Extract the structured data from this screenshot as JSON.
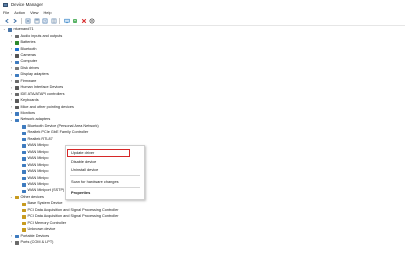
{
  "window": {
    "title": "Device Manager"
  },
  "menu": [
    "File",
    "Action",
    "View",
    "Help"
  ],
  "toolbar": [
    {
      "name": "back-icon",
      "color": "#3a6ea5"
    },
    {
      "name": "forward-icon",
      "color": "#3a6ea5"
    },
    {
      "name": "properties-icon",
      "color": "#5a7fa8"
    },
    {
      "name": "view-icon",
      "color": "#5a7fa8"
    },
    {
      "name": "help-icon",
      "color": "#3a6ea5"
    },
    {
      "name": "details-icon",
      "color": "#5a7fa8"
    },
    {
      "name": "monitor-icon",
      "color": "#2d7fc4"
    },
    {
      "name": "update-driver-icon",
      "color": "#2a9d3a"
    },
    {
      "name": "uninstall-icon",
      "color": "#d62828"
    },
    {
      "name": "scan-hardware-icon",
      "color": "#333333"
    }
  ],
  "tree": [
    {
      "label": "ntuenand71",
      "level": 0,
      "chev": "v",
      "color": "#4a76a8"
    },
    {
      "label": "Audio inputs and outputs",
      "level": 1,
      "chev": ">",
      "color": "#6b6b6b"
    },
    {
      "label": "Batteries",
      "level": 1,
      "chev": ">",
      "color": "#2d8a2d"
    },
    {
      "label": "Bluetooth",
      "level": 1,
      "chev": ">",
      "color": "#1e6fd0"
    },
    {
      "label": "Cameras",
      "level": 1,
      "chev": ">",
      "color": "#555555"
    },
    {
      "label": "Computer",
      "level": 1,
      "chev": ">",
      "color": "#3e7bbf"
    },
    {
      "label": "Disk drives",
      "level": 1,
      "chev": ">",
      "color": "#7a7a7a"
    },
    {
      "label": "Display adapters",
      "level": 1,
      "chev": ">",
      "color": "#3e7bbf"
    },
    {
      "label": "Firmware",
      "level": 1,
      "chev": ">",
      "color": "#6a6a6a"
    },
    {
      "label": "Human Interface Devices",
      "level": 1,
      "chev": ">",
      "color": "#5a5a5a"
    },
    {
      "label": "IDE ATA/ATAPI controllers",
      "level": 1,
      "chev": ">",
      "color": "#6a6a6a"
    },
    {
      "label": "Keyboards",
      "level": 1,
      "chev": ">",
      "color": "#5a5a5a"
    },
    {
      "label": "Mice and other pointing devices",
      "level": 1,
      "chev": ">",
      "color": "#5a5a5a"
    },
    {
      "label": "Monitors",
      "level": 1,
      "chev": ">",
      "color": "#3e7bbf"
    },
    {
      "label": "Network adapters",
      "level": 1,
      "chev": "v",
      "color": "#3e7bbf"
    },
    {
      "label": "Bluetooth Device (Personal Area Network)",
      "level": 2,
      "chev": "",
      "color": "#3e7bbf"
    },
    {
      "label": "Realtek PCIe GbE Family Controller",
      "level": 2,
      "chev": "",
      "color": "#3e7bbf"
    },
    {
      "label": "Realtek RTL87",
      "level": 2,
      "chev": "",
      "color": "#3e7bbf"
    },
    {
      "label": "WAN Minipo",
      "level": 2,
      "chev": "",
      "color": "#3e7bbf"
    },
    {
      "label": "WAN Minipo",
      "level": 2,
      "chev": "",
      "color": "#3e7bbf"
    },
    {
      "label": "WAN Minipo",
      "level": 2,
      "chev": "",
      "color": "#3e7bbf"
    },
    {
      "label": "WAN Minipo",
      "level": 2,
      "chev": "",
      "color": "#3e7bbf"
    },
    {
      "label": "WAN Minipo",
      "level": 2,
      "chev": "",
      "color": "#3e7bbf"
    },
    {
      "label": "WAN Minipo",
      "level": 2,
      "chev": "",
      "color": "#3e7bbf"
    },
    {
      "label": "WAN Minipo",
      "level": 2,
      "chev": "",
      "color": "#3e7bbf"
    },
    {
      "label": "WAN Miniport (SSTP)",
      "level": 2,
      "chev": "",
      "color": "#3e7bbf"
    },
    {
      "label": "Other devices",
      "level": 1,
      "chev": "v",
      "color": "#c79a1e"
    },
    {
      "label": "Base System Device",
      "level": 2,
      "chev": "",
      "color": "#c79a1e"
    },
    {
      "label": "PCI Data Acquisition and Signal Processing Controller",
      "level": 2,
      "chev": "",
      "color": "#c79a1e"
    },
    {
      "label": "PCI Data Acquisition and Signal Processing Controller",
      "level": 2,
      "chev": "",
      "color": "#c79a1e"
    },
    {
      "label": "PCI Memory Controller",
      "level": 2,
      "chev": "",
      "color": "#c79a1e"
    },
    {
      "label": "Unknown device",
      "level": 2,
      "chev": "",
      "color": "#c79a1e"
    },
    {
      "label": "Portable Devices",
      "level": 1,
      "chev": ">",
      "color": "#3e7bbf"
    },
    {
      "label": "Ports (COM & LPT)",
      "level": 1,
      "chev": ">",
      "color": "#6a6a6a"
    }
  ],
  "context_menu": {
    "items": [
      "Update driver",
      "Disable device",
      "Uninstall device",
      "Scan for hardware changes",
      "Properties"
    ],
    "highlighted": "Update driver",
    "highlight_color": "#d62828"
  }
}
